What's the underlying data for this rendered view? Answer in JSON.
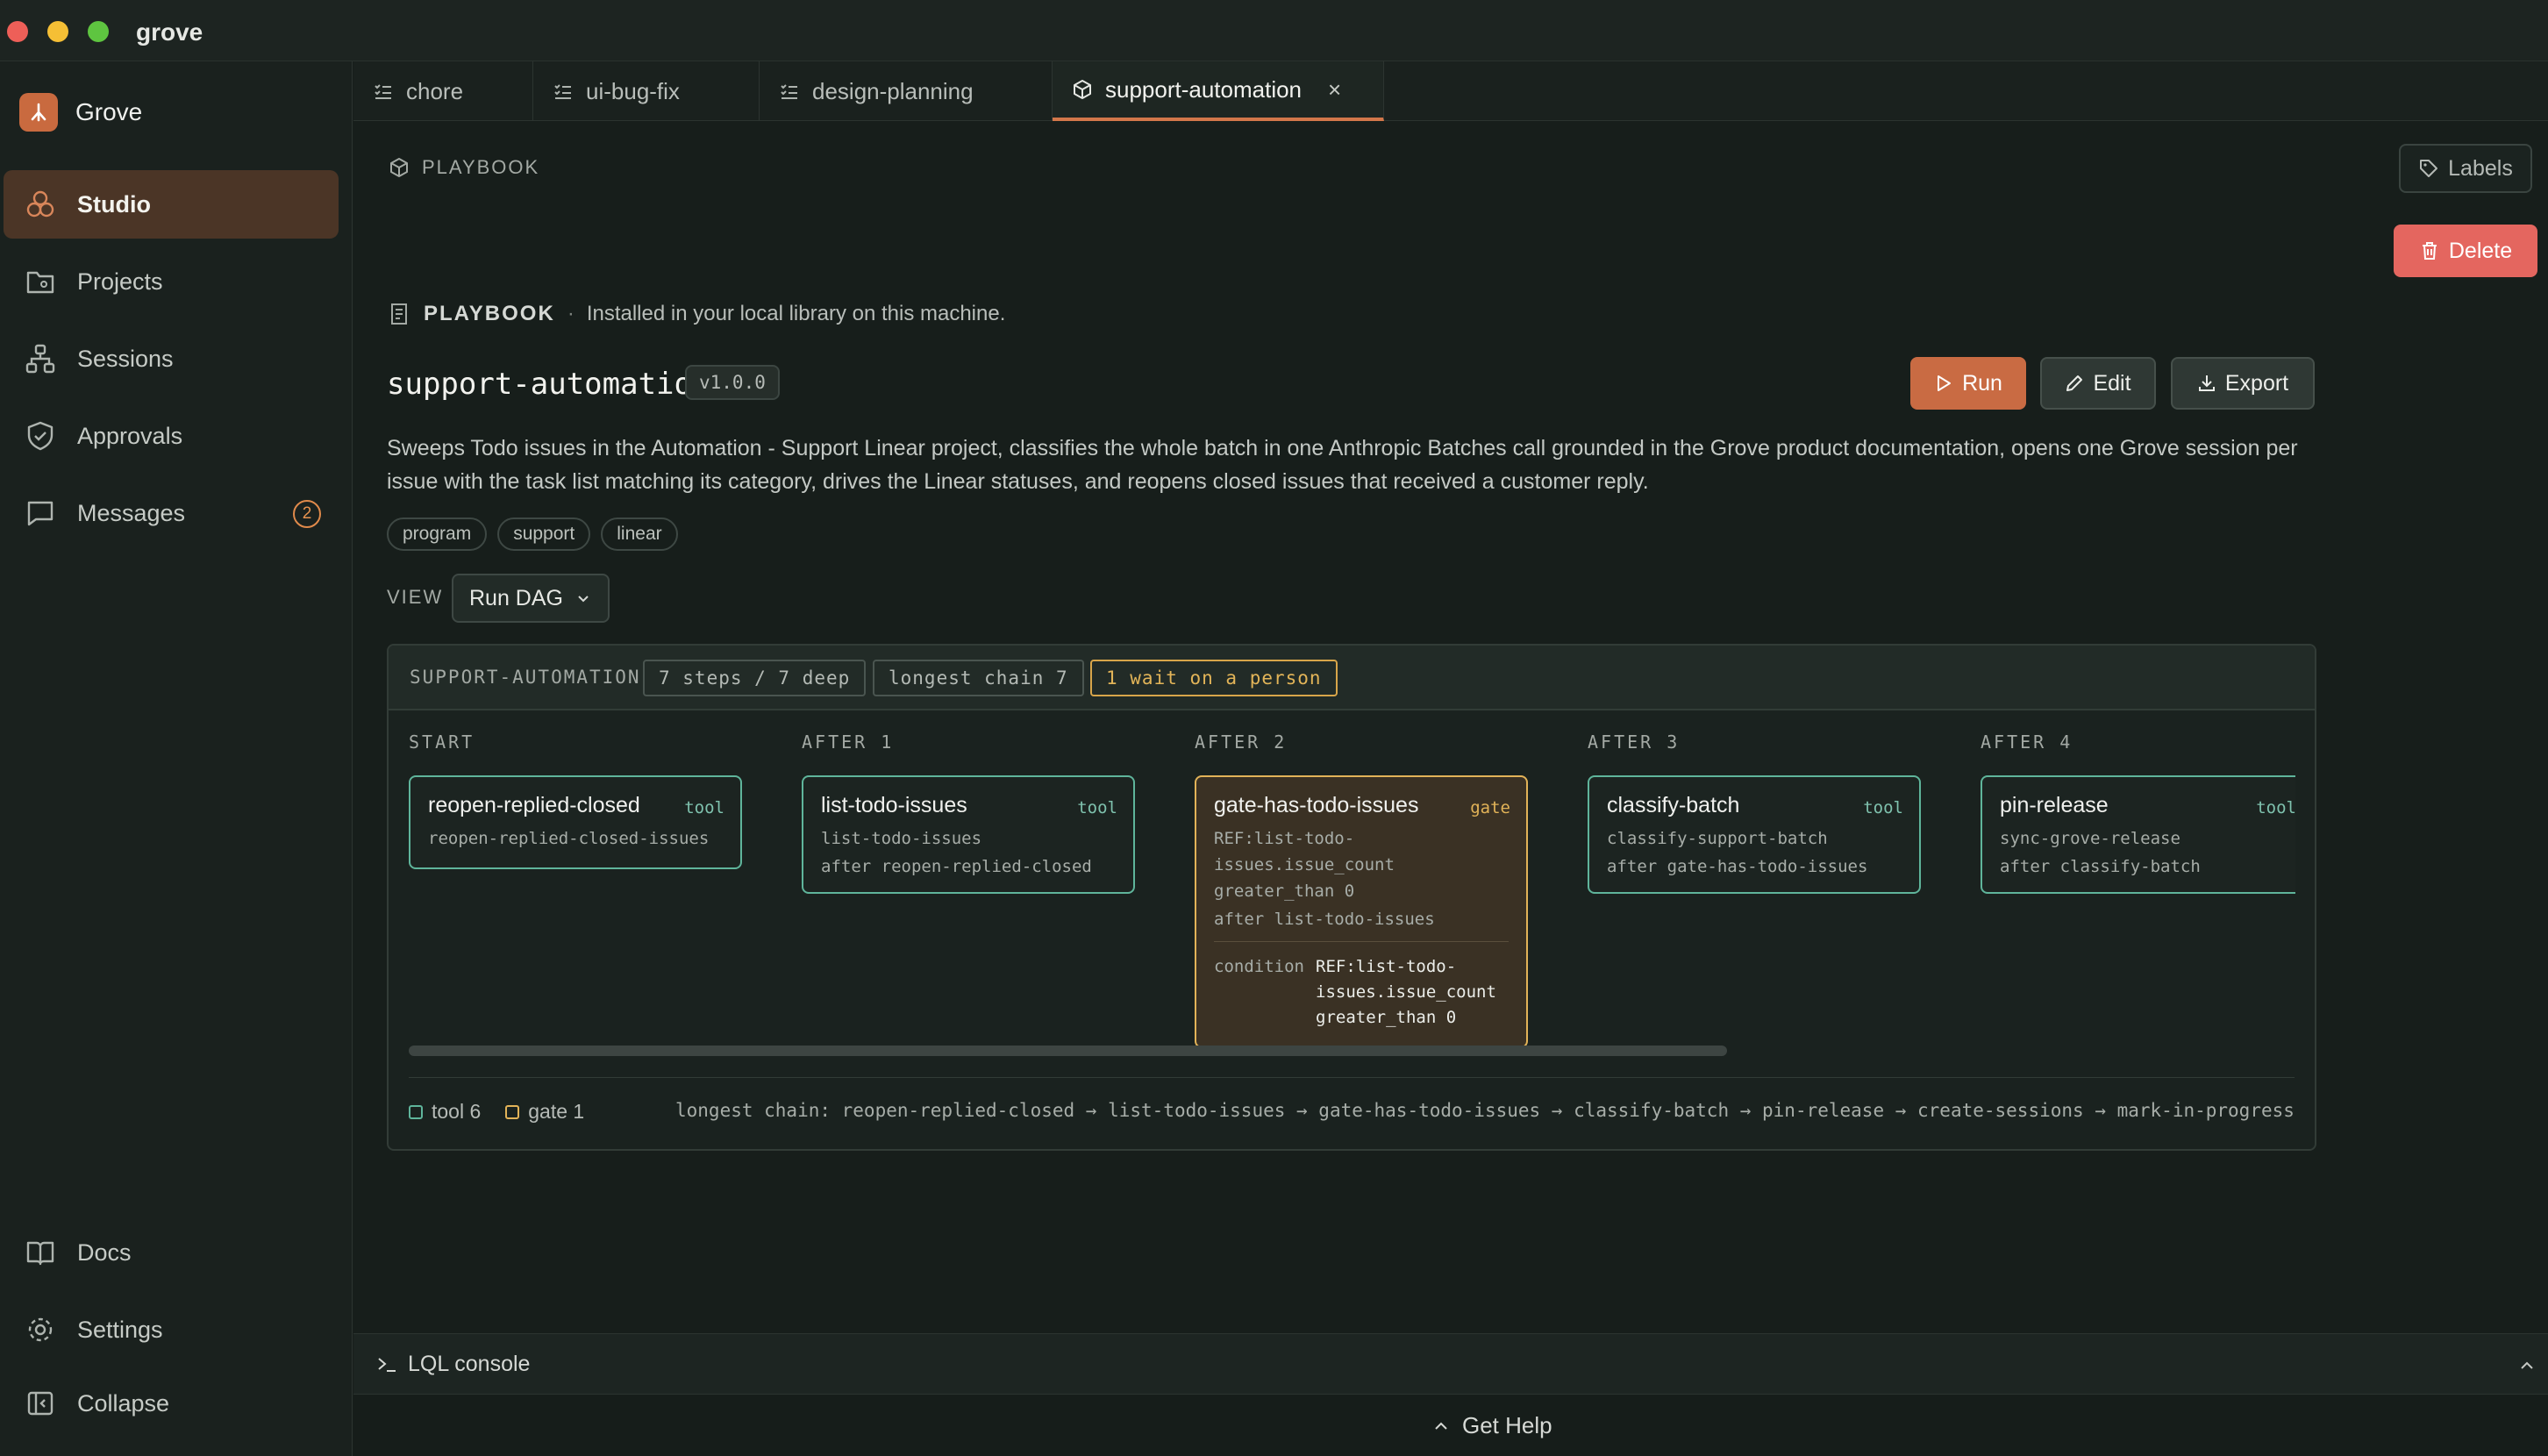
{
  "window": {
    "title": "grove"
  },
  "sidebar": {
    "brand": "Grove",
    "items": [
      {
        "label": "Studio"
      },
      {
        "label": "Projects"
      },
      {
        "label": "Sessions"
      },
      {
        "label": "Approvals"
      },
      {
        "label": "Messages",
        "badge": "2"
      }
    ],
    "bottom": [
      {
        "label": "Docs"
      },
      {
        "label": "Settings"
      },
      {
        "label": "Collapse"
      }
    ]
  },
  "tabs": [
    {
      "label": "chore"
    },
    {
      "label": "ui-bug-fix"
    },
    {
      "label": "design-planning"
    },
    {
      "label": "support-automation",
      "close": "×"
    }
  ],
  "header": {
    "crumb": "PLAYBOOK",
    "labels_button": "Labels",
    "delete_button": "Delete"
  },
  "playbook": {
    "section_label": "PLAYBOOK",
    "separator": "·",
    "section_note": "Installed in your local library on this machine.",
    "name": "support-automation",
    "version": "v1.0.0",
    "actions": {
      "run": "Run",
      "edit": "Edit",
      "export": "Export"
    },
    "description": "Sweeps Todo issues in the Automation - Support Linear project, classifies the whole batch in one Anthropic Batches call grounded in the Grove product documentation, opens one Grove session per issue with the task list matching its category, drives the Linear statuses, and reopens closed issues that received a customer reply.",
    "tags": [
      "program",
      "support",
      "linear"
    ],
    "view": {
      "label": "VIEW",
      "selected": "Run DAG"
    }
  },
  "dag": {
    "name": "SUPPORT-AUTOMATION",
    "chips": [
      "7 steps / 7 deep",
      "longest chain 7",
      "1 wait on a person"
    ],
    "columns": [
      "START",
      "AFTER 1",
      "AFTER 2",
      "AFTER 3",
      "AFTER 4"
    ],
    "nodes": [
      {
        "title": "reopen-replied-closed",
        "kind": "tool",
        "detail": "reopen-replied-closed-issues"
      },
      {
        "title": "list-todo-issues",
        "kind": "tool",
        "detail": "list-todo-issues",
        "after": "after reopen-replied-closed"
      },
      {
        "title": "gate-has-todo-issues",
        "kind": "gate",
        "detail": "REF:list-todo-issues.issue_count greater_than 0",
        "after": "after list-todo-issues",
        "cond_key": "condition",
        "cond_value": "REF:list-todo-issues.issue_count greater_than 0"
      },
      {
        "title": "classify-batch",
        "kind": "tool",
        "detail": "classify-support-batch",
        "after": "after gate-has-todo-issues"
      },
      {
        "title": "pin-release",
        "kind": "tool",
        "detail": "sync-grove-release",
        "after": "after classify-batch"
      }
    ],
    "legend": {
      "tool": "tool 6",
      "gate": "gate 1"
    },
    "chain": "longest chain: reopen-replied-closed → list-todo-issues → gate-has-todo-issues → classify-batch → pin-release → create-sessions → mark-in-progress"
  },
  "console": {
    "label": "LQL console"
  },
  "help": {
    "label": "Get Help"
  },
  "colors": {
    "accent": "#c96b43",
    "danger": "#e4665f",
    "tool": "#5fb59b",
    "gate": "#e2b358"
  }
}
